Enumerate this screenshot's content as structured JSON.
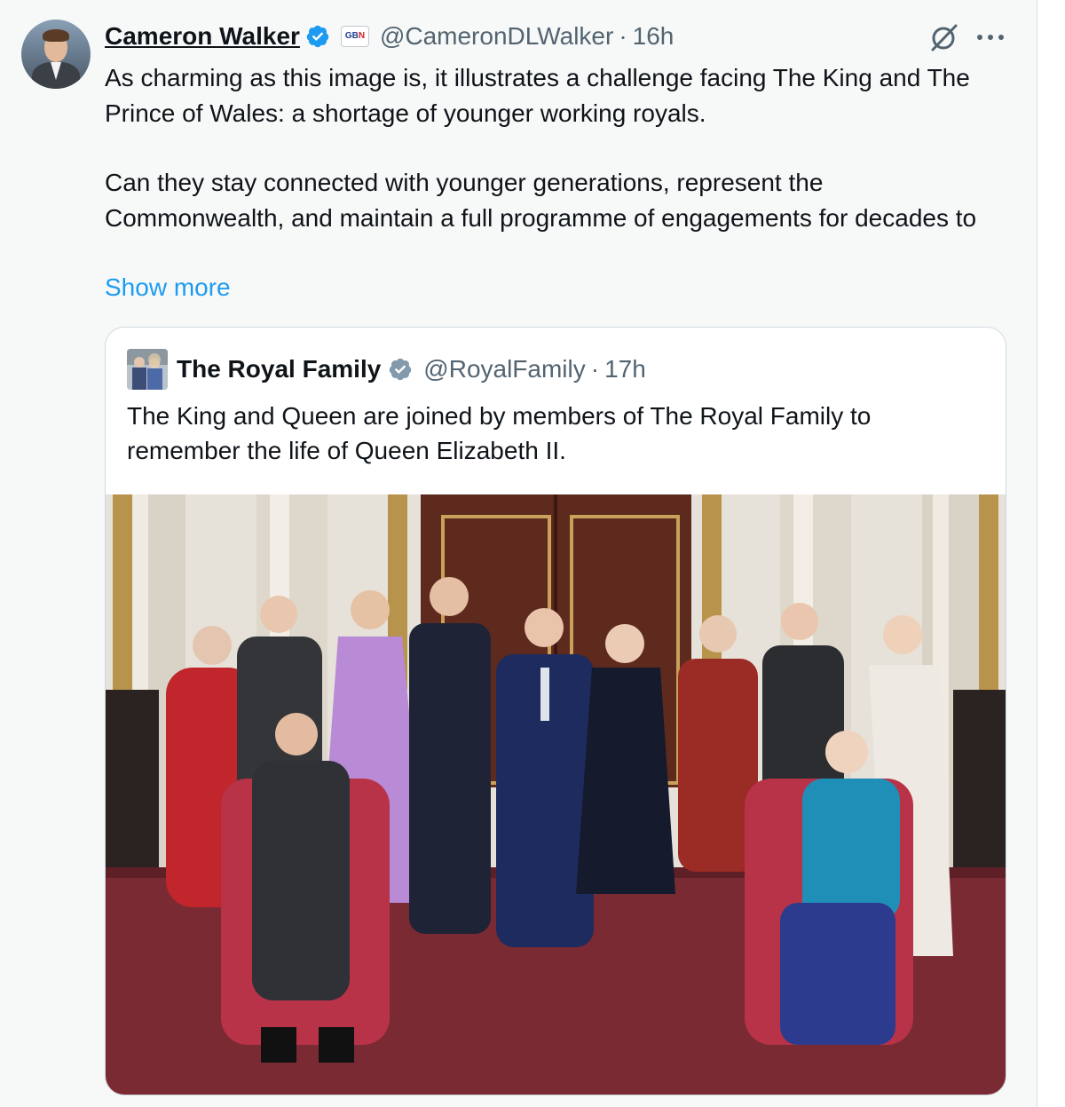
{
  "author": {
    "name": "Cameron Walker",
    "affiliation_badge": "GB News",
    "handle": "@CameronDLWalker",
    "separator": "·",
    "time": "16h",
    "verified_color": "#1d9bf0"
  },
  "body": {
    "paragraph1": "As charming as this image is, it illustrates a challenge facing The King and The Prince of Wales: a shortage of younger working royals.",
    "paragraph2": "Can they stay connected with younger generations, represent the Commonwealth, and maintain a full programme of engagements for decades to",
    "show_more": "Show more"
  },
  "quoted": {
    "name": "The Royal Family",
    "handle": "@RoyalFamily",
    "separator": "·",
    "time": "17h",
    "verified_color": "#829aab",
    "text": "The King and Queen are joined by members of The Royal Family to remember the life of Queen Elizabeth II."
  },
  "icons": {
    "grok": "grok-icon",
    "more": "more-options-icon",
    "verified": "verified-badge-icon"
  },
  "colors": {
    "link": "#1d9bf0",
    "secondary_text": "#536471",
    "carpet": "#7a2a33",
    "wall": "#e8e3dc"
  }
}
